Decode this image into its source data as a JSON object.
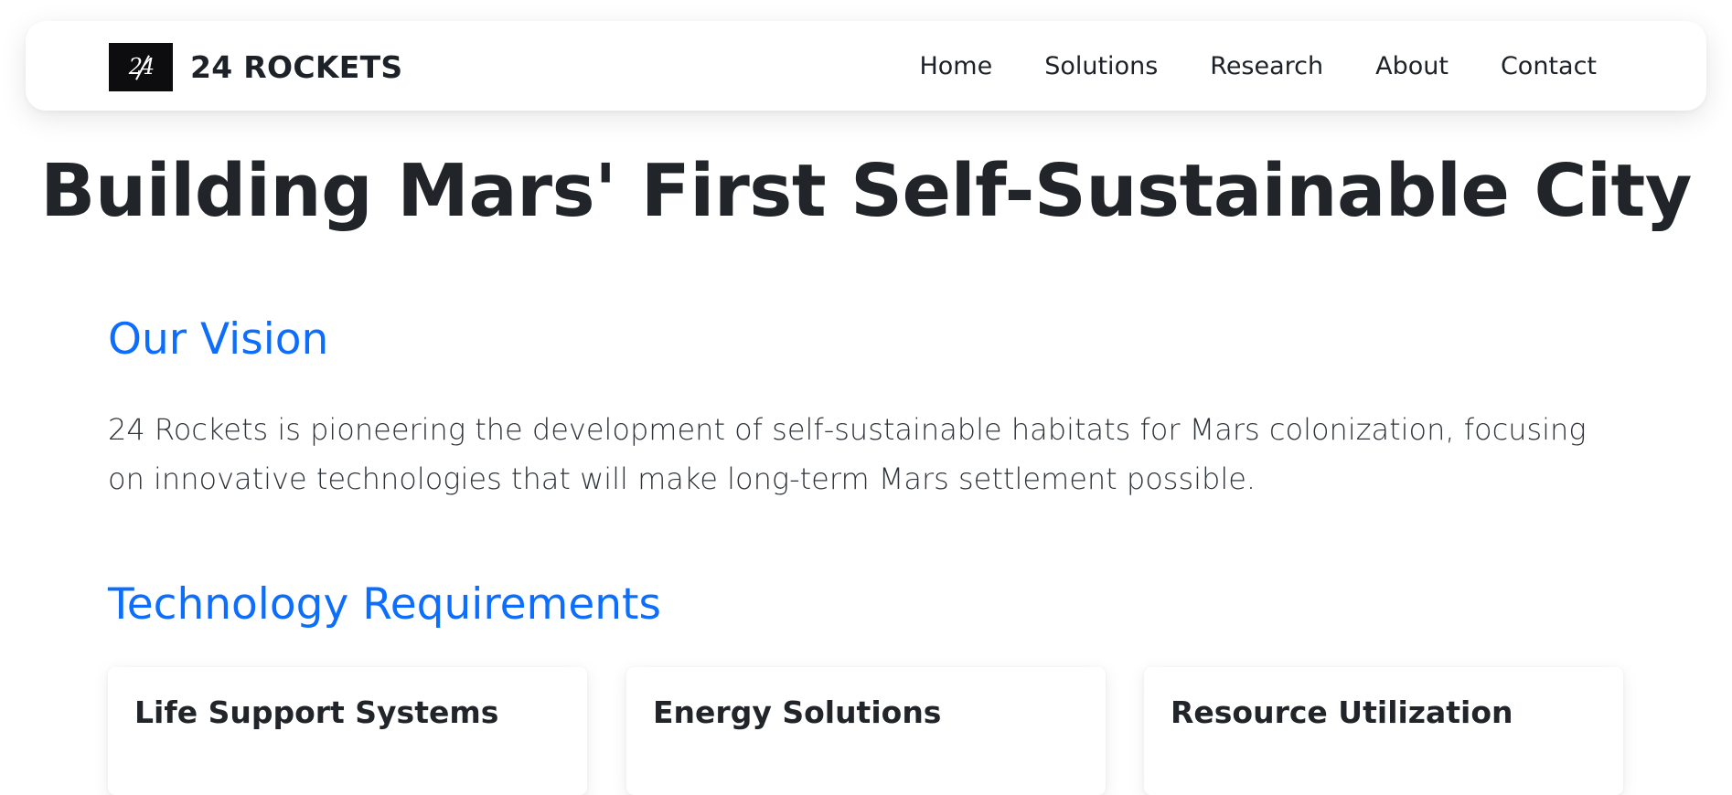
{
  "brand": {
    "logo_text": "24",
    "name": "24 ROCKETS"
  },
  "nav": {
    "items": [
      {
        "label": "Home"
      },
      {
        "label": "Solutions"
      },
      {
        "label": "Research"
      },
      {
        "label": "About"
      },
      {
        "label": "Contact"
      }
    ]
  },
  "hero": {
    "title": "Building Mars' First Self-Sustainable City"
  },
  "vision": {
    "heading": "Our Vision",
    "text": "24 Rockets is pioneering the development of self-sustainable habitats for Mars colonization, focusing on innovative technologies that will make long-term Mars settlement possible."
  },
  "technology": {
    "heading": "Technology Requirements",
    "cards": [
      {
        "title": "Life Support Systems"
      },
      {
        "title": "Energy Solutions"
      },
      {
        "title": "Resource Utilization"
      }
    ]
  },
  "colors": {
    "accent": "#0d6efd",
    "text": "#212529",
    "logo_bg": "#0d0d0f"
  }
}
